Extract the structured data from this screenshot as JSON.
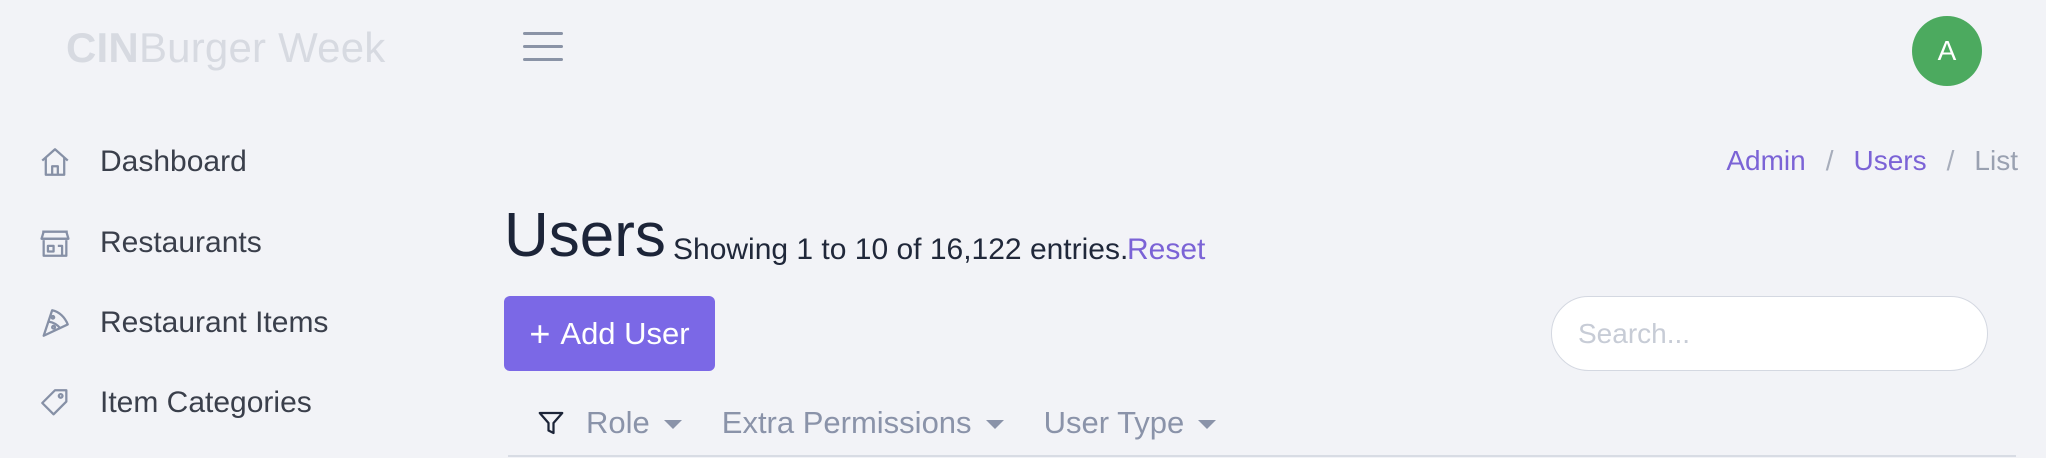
{
  "header": {
    "brand_bold": "CIN",
    "brand_rest": "Burger Week",
    "avatar_initial": "A"
  },
  "sidebar": {
    "items": [
      {
        "label": "Dashboard",
        "icon": "home-icon"
      },
      {
        "label": "Restaurants",
        "icon": "store-icon"
      },
      {
        "label": "Restaurant Items",
        "icon": "pizza-slice-icon"
      },
      {
        "label": "Item Categories",
        "icon": "tag-icon"
      }
    ]
  },
  "breadcrumb": {
    "items": [
      "Admin",
      "Users",
      "List"
    ],
    "separator": "/"
  },
  "main": {
    "title": "Users",
    "showing_text": "Showing 1 to 10 of 16,122 entries.",
    "reset_label": "Reset",
    "add_button_label": "Add User",
    "search_placeholder": "Search..."
  },
  "filters": {
    "items": [
      "Role",
      "Extra Permissions",
      "User Type"
    ]
  },
  "colors": {
    "accent": "#7b68e6",
    "link": "#7b63d6",
    "avatar": "#4caa5f",
    "background": "#f2f3f7"
  }
}
